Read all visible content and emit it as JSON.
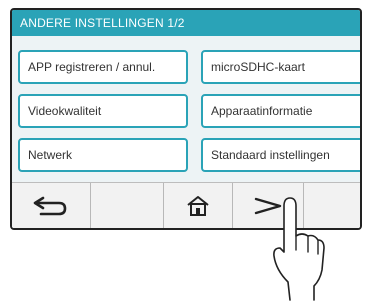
{
  "header": {
    "title": "ANDERE INSTELLINGEN 1/2"
  },
  "menu": {
    "items": [
      {
        "label": "APP registreren / annul."
      },
      {
        "label": "microSDHC-kaart"
      },
      {
        "label": "Videokwaliteit"
      },
      {
        "label": "Apparaatinformatie"
      },
      {
        "label": "Netwerk"
      },
      {
        "label": "Standaard instellingen"
      }
    ]
  },
  "nav": {
    "back_icon": "return-arrow-icon",
    "home_icon": "home-icon",
    "next_icon": "chevron-right-icon"
  },
  "colors": {
    "accent": "#2aa3b7",
    "menu_bg": "#edf3f5",
    "nav_bg": "#f2f2f2"
  }
}
